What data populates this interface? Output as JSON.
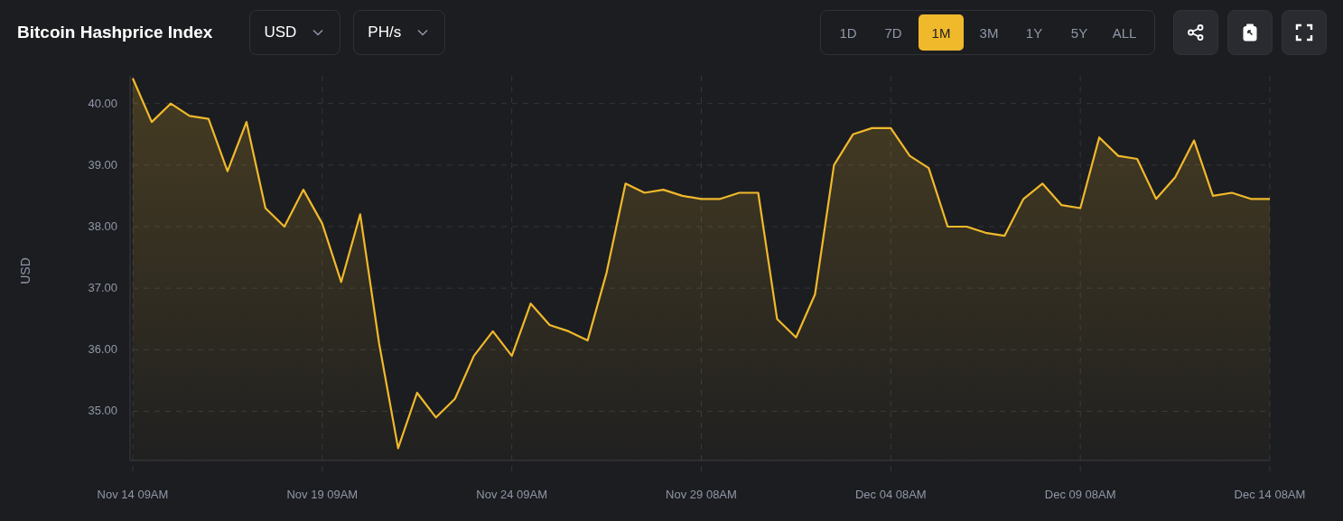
{
  "header": {
    "title": "Bitcoin Hashprice Index",
    "dropdowns": [
      {
        "value": "USD"
      },
      {
        "value": "PH/s"
      }
    ]
  },
  "ranges": [
    {
      "label": "1D",
      "selected": false
    },
    {
      "label": "7D",
      "selected": false
    },
    {
      "label": "1M",
      "selected": true
    },
    {
      "label": "3M",
      "selected": false
    },
    {
      "label": "1Y",
      "selected": false
    },
    {
      "label": "5Y",
      "selected": false
    },
    {
      "label": "ALL",
      "selected": false
    }
  ],
  "actions": [
    {
      "kind": "share"
    },
    {
      "kind": "copy"
    },
    {
      "kind": "fullscreen"
    }
  ],
  "chart": {
    "chart_data": {
      "type": "area",
      "grid": true,
      "ylabel": "USD",
      "ylim": [
        34.2,
        40.45
      ],
      "yticks": [
        {
          "value": 35,
          "label": "35.00"
        },
        {
          "value": 36,
          "label": "36.00"
        },
        {
          "value": 37,
          "label": "37.00"
        },
        {
          "value": 38,
          "label": "38.00"
        },
        {
          "value": 39,
          "label": "39.00"
        },
        {
          "value": 40,
          "label": "40.00"
        }
      ],
      "categories": [
        "Nov 14 09AM",
        null,
        null,
        null,
        null,
        null,
        null,
        null,
        null,
        null,
        "Nov 19 09AM",
        null,
        null,
        null,
        null,
        null,
        null,
        null,
        null,
        null,
        "Nov 24 09AM",
        null,
        null,
        null,
        null,
        null,
        null,
        null,
        null,
        null,
        "Nov 29 08AM",
        null,
        null,
        null,
        null,
        null,
        null,
        null,
        null,
        null,
        "Dec 04 08AM",
        null,
        null,
        null,
        null,
        null,
        null,
        null,
        null,
        null,
        "Dec 09 08AM",
        null,
        null,
        null,
        null,
        null,
        null,
        null,
        null,
        null,
        "Dec 14 08AM"
      ],
      "series": [
        {
          "color": "#f0b92c",
          "values": [
            40.41,
            39.7,
            40.0,
            39.8,
            39.75,
            38.9,
            39.7,
            38.3,
            38.0,
            38.6,
            38.05,
            37.1,
            38.2,
            36.1,
            34.4,
            35.3,
            34.9,
            35.2,
            35.9,
            36.3,
            35.9,
            36.75,
            36.4,
            36.3,
            36.15,
            37.25,
            38.7,
            38.55,
            38.6,
            38.5,
            38.45,
            38.45,
            38.55,
            38.55,
            36.5,
            36.2,
            36.9,
            39.0,
            39.5,
            39.6,
            39.6,
            39.15,
            38.95,
            38.0,
            38.0,
            37.9,
            37.85,
            38.45,
            38.7,
            38.35,
            38.3,
            39.45,
            39.15,
            39.1,
            38.45,
            38.8,
            39.4,
            38.5,
            38.55,
            38.45,
            38.45
          ]
        }
      ]
    }
  }
}
